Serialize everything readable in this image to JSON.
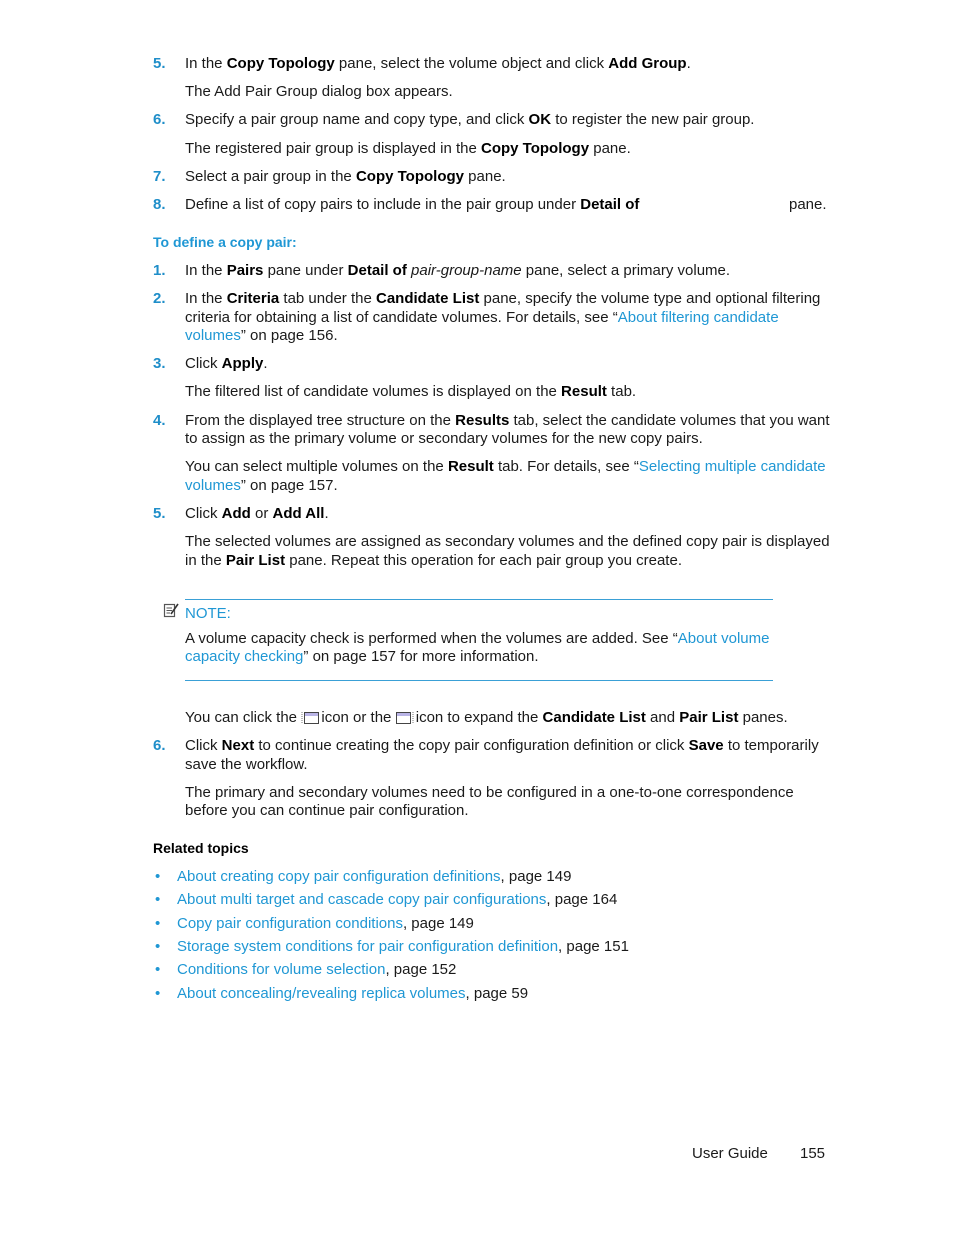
{
  "steps_top": [
    {
      "num": "5.",
      "pre": "In the ",
      "b1": "Copy Topology",
      "mid": " pane, select the volume object and click ",
      "b2": "Add Group",
      "post": ".",
      "note": "The Add Pair Group dialog box appears."
    },
    {
      "num": "6.",
      "pre": "Specify a pair group name and copy type, and click ",
      "b1": "OK",
      "post": " to register the new pair group.",
      "note_pre": "The registered pair group is displayed in the ",
      "note_b": "Copy Topology",
      "note_post": " pane."
    },
    {
      "num": "7.",
      "pre": "Select a pair group in the ",
      "b1": "Copy Topology",
      "post": " pane."
    },
    {
      "num": "8.",
      "pre": "Define a list of copy pairs to include in the pair group under ",
      "b1": "Detail of",
      "post": "pane."
    }
  ],
  "procedure_heading": "To define a copy pair:",
  "steps": {
    "s1": {
      "num": "1.",
      "pre": "In the ",
      "b1": "Pairs",
      "mid": " pane under ",
      "b2": "Detail of",
      "italic": " pair-group-name",
      "post": " pane, select a primary volume."
    },
    "s2": {
      "num": "2.",
      "pre": "In the ",
      "b1": "Criteria",
      "mid": " tab under the ",
      "b2": "Candidate List",
      "post": " pane, specify the volume type and optional filtering",
      "line2_pre": "criteria for obtaining a list of candidate volumes. For details, see “",
      "link_a": "About filtering candidate",
      "link_b": "volumes",
      "line3_post": "” on page 156."
    },
    "s3": {
      "num": "3.",
      "pre": "Click ",
      "b1": "Apply",
      "post": ".",
      "note_pre": "The filtered list of candidate volumes is displayed on the ",
      "note_b": "Result",
      "note_post": " tab."
    },
    "s4": {
      "num": "4.",
      "pre": "From the displayed tree structure on the ",
      "b1": "Results",
      "post": " tab, select the candidate volumes that you want",
      "line2": "to assign as the primary volume or secondary volumes for the new copy pairs.",
      "note_pre": "You can select multiple volumes on the ",
      "note_b": "Result",
      "note_mid": " tab. For details, see “",
      "link_a": "Selecting multiple candidate",
      "link_b": "volumes",
      "note_post": "” on page 157."
    },
    "s5": {
      "num": "5.",
      "pre": "Click ",
      "b1": "Add",
      "mid": " or ",
      "b2": "Add All",
      "post": ".",
      "note_line1": "The selected volumes are assigned as secondary volumes and the defined copy pair is displayed",
      "note_pre": "in the ",
      "note_b": "Pair List",
      "note_post": " pane. Repeat this operation for each pair group you create."
    }
  },
  "note": {
    "label": "NOTE:",
    "pre": "A volume capacity check is performed when the volumes are added. See “",
    "link_a": "About volume",
    "link_b": "capacity checking",
    "post": "” on page 157 for more information."
  },
  "expand_line": {
    "pre": "You can click the ",
    "mid": " icon or the ",
    "mid2": " icon to expand the ",
    "b1": "Candidate List",
    "and": " and ",
    "b2": "Pair List",
    "post": " panes."
  },
  "s6": {
    "num": "6.",
    "pre": "Click ",
    "b1": "Next",
    "mid": " to continue creating the copy pair configuration definition or click ",
    "b2": "Save",
    "post": " to temporarily",
    "line2": "save the workflow.",
    "note_line1": "The primary and secondary volumes need to be configured in a one-to-one correspondence",
    "note_line2": "before you can continue pair configuration."
  },
  "related": {
    "title": "Related topics",
    "items": [
      {
        "link": "About creating copy pair configuration definitions",
        "page": ", page 149"
      },
      {
        "link": "About multi target and cascade copy pair configurations",
        "page": ", page 164"
      },
      {
        "link": "Copy pair configuration conditions",
        "page": ", page 149"
      },
      {
        "link": "Storage system conditions for pair configuration definition",
        "page": ", page 151"
      },
      {
        "link": "Conditions for volume selection",
        "page": ", page 152"
      },
      {
        "link": "About concealing/revealing replica volumes",
        "page": ", page 59"
      }
    ]
  },
  "footer": {
    "guide": "User Guide",
    "page": "155"
  }
}
